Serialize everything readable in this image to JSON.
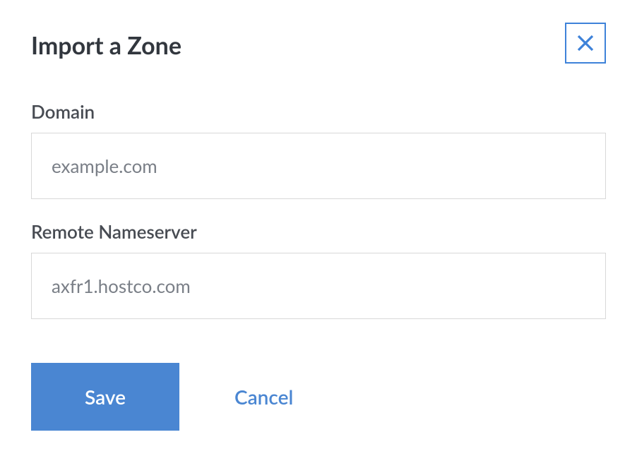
{
  "dialog": {
    "title": "Import a Zone",
    "close_label": "Close"
  },
  "form": {
    "domain": {
      "label": "Domain",
      "placeholder": "example.com",
      "value": ""
    },
    "remote_nameserver": {
      "label": "Remote Nameserver",
      "placeholder": "axfr1.hostco.com",
      "value": ""
    }
  },
  "actions": {
    "save_label": "Save",
    "cancel_label": "Cancel"
  },
  "colors": {
    "accent": "#4a86d2",
    "accent_border": "#3e82d9",
    "text": "#32373e",
    "label": "#474b52",
    "placeholder": "#7a7f87",
    "input_border": "#d8d8d8"
  }
}
